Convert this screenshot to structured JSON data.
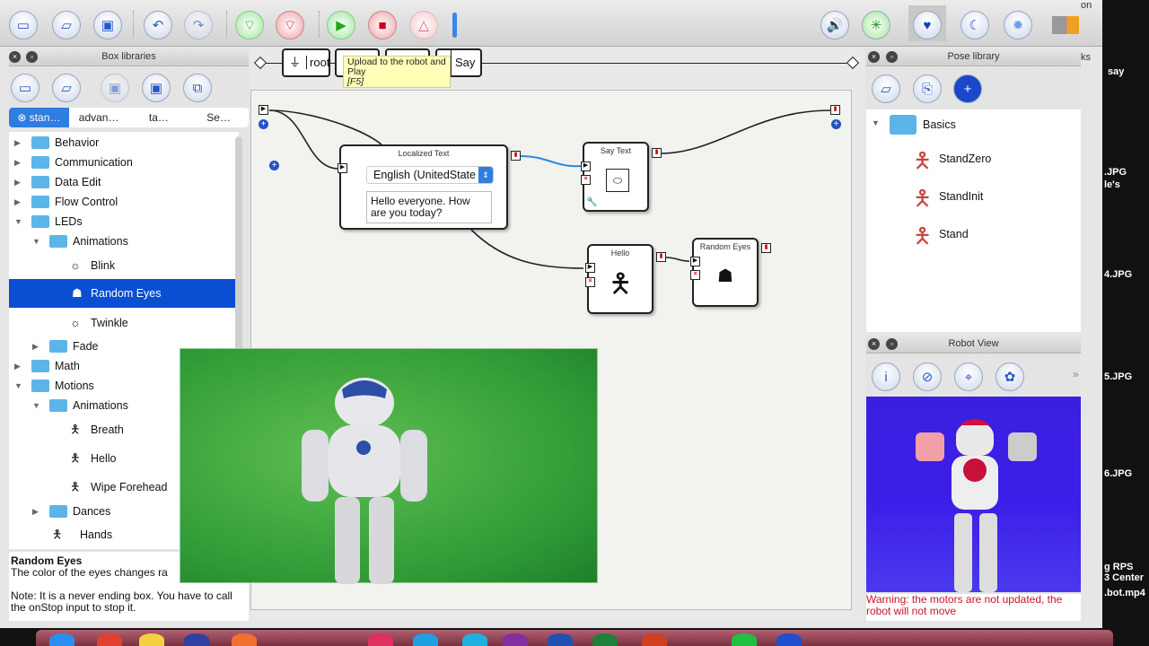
{
  "toolbar": {
    "icons": [
      "new-project-icon",
      "open-project-icon",
      "save-project-icon",
      "undo-icon",
      "redo-icon",
      "connect-icon",
      "disconnect-icon",
      "play-icon",
      "stop-icon",
      "debug-icon",
      "volume-icon",
      "animation-mode-icon",
      "stiffness-icon",
      "rest-icon",
      "wake-up-icon",
      "battery-icon"
    ]
  },
  "tooltip": {
    "line1": "Upload to the robot and",
    "line2": "Play",
    "shortcut": "[F5]"
  },
  "box_libraries": {
    "title": "Box libraries",
    "tabs": [
      "stan…",
      "advan…",
      "ta…",
      "Se…"
    ],
    "tree": [
      {
        "label": "Behavior"
      },
      {
        "label": "Communication"
      },
      {
        "label": "Data Edit"
      },
      {
        "label": "Flow Control"
      },
      {
        "label": "LEDs"
      },
      {
        "label": "Animations"
      },
      {
        "label": "Blink"
      },
      {
        "label": "Random Eyes"
      },
      {
        "label": "Twinkle"
      },
      {
        "label": "Fade"
      },
      {
        "label": "Math"
      },
      {
        "label": "Motions"
      },
      {
        "label": "Animations"
      },
      {
        "label": "Breath"
      },
      {
        "label": "Hello"
      },
      {
        "label": "Wipe Forehead"
      },
      {
        "label": "Dances"
      },
      {
        "label": "Hands"
      }
    ],
    "description": {
      "title": "Random Eyes",
      "text": "The color of the eyes changes ra",
      "note": "Note: It is a never ending box. You have to call the onStop input to stop it."
    }
  },
  "flow": {
    "breadcrumb": [
      "root",
      "Say"
    ],
    "boxes": {
      "localized_text": {
        "title": "Localized Text",
        "language": "English (UnitedState",
        "text": "Hello everyone. How are you today?"
      },
      "say_text": {
        "title": "Say Text"
      },
      "hello": {
        "title": "Hello"
      },
      "random_eyes": {
        "title": "Random Eyes"
      }
    }
  },
  "pose_library": {
    "title": "Pose library",
    "group": "Basics",
    "poses": [
      "StandZero",
      "StandInit",
      "Stand"
    ]
  },
  "robot_view": {
    "title": "Robot View",
    "warning": "Warning: the motors are not updated, the robot will not move"
  },
  "desktop": {
    "labels": [
      "on",
      "ks",
      "say",
      ".JPG",
      "le's",
      "4.JPG",
      "5.JPG",
      "6.JPG",
      "g RPS",
      "3 Center",
      ".bot.mp4"
    ]
  }
}
